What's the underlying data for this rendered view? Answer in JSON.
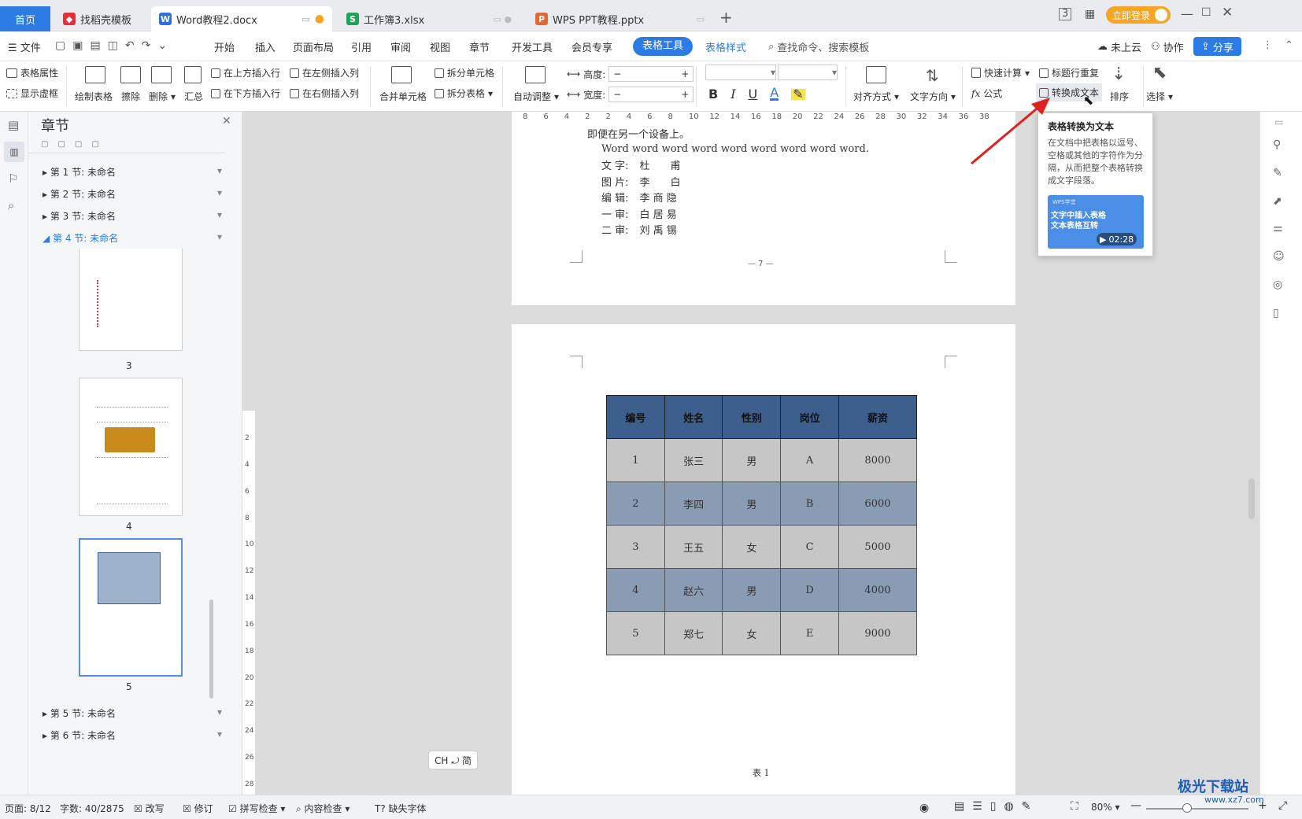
{
  "tabs": {
    "home": "首页",
    "templates": "找稻壳模板",
    "doc": "Word教程2.docx",
    "xls": "工作簿3.xlsx",
    "ppt": "WPS PPT教程.pptx",
    "login": "立即登录"
  },
  "menu": {
    "file": "文件",
    "items": [
      "开始",
      "插入",
      "页面布局",
      "引用",
      "审阅",
      "视图",
      "章节",
      "开发工具",
      "会员专享"
    ],
    "table_tools": "表格工具",
    "table_style": "表格样式",
    "search": "查找命令、搜索模板",
    "cloud": "未上云",
    "collab": "协作",
    "share": "分享"
  },
  "ribbon": {
    "table_props": "表格属性",
    "show_grid": "显示虚框",
    "draw_table": "绘制表格",
    "erase": "擦除",
    "delete": "删除",
    "summary": "汇总",
    "insert_above": "在上方插入行",
    "insert_below": "在下方插入行",
    "insert_left": "在左侧插入列",
    "insert_right": "在右侧插入列",
    "merge": "合并单元格",
    "split_cell": "拆分单元格",
    "split_table": "拆分表格",
    "auto_adjust": "自动调整",
    "height": "高度:",
    "width": "宽度:",
    "align": "对齐方式",
    "text_dir": "文字方向",
    "quick_calc": "快速计算",
    "title_repeat": "标题行重复",
    "formula": "公式",
    "convert_text": "转换成文本",
    "sort": "排序",
    "select": "选择"
  },
  "ruler_ticks": [
    "8",
    "6",
    "4",
    "2",
    "2",
    "4",
    "6",
    "8",
    "10",
    "12",
    "14",
    "16",
    "18",
    "20",
    "22",
    "24",
    "26",
    "28",
    "30",
    "32",
    "34",
    "36",
    "38"
  ],
  "vruler_ticks": [
    "2",
    "4",
    "6",
    "8",
    "10",
    "12",
    "14",
    "16",
    "18",
    "20",
    "22",
    "24",
    "26",
    "28"
  ],
  "panel": {
    "title": "章节",
    "sections": [
      "第 1 节: 未命名",
      "第 2 节: 未命名",
      "第 3 节: 未命名",
      "第 4 节: 未命名",
      "第 5 节: 未命名",
      "第 6 节: 未命名"
    ],
    "page_nums": [
      "3",
      "4",
      "5"
    ]
  },
  "doc": {
    "line0": "即便在另一个设备上。",
    "line1": "Word word word word word word word word word.",
    "credits": [
      {
        "k": "文 字:",
        "v": "杜　　甫"
      },
      {
        "k": "图 片:",
        "v": "李　　白"
      },
      {
        "k": "编 辑:",
        "v": "李 商 隐"
      },
      {
        "k": "一 审:",
        "v": "白 居 易"
      },
      {
        "k": "二 审:",
        "v": "刘 禹 锡"
      }
    ],
    "page_footer": "— 7 —",
    "caption": "表 1",
    "table_header": [
      "编号",
      "姓名",
      "性别",
      "岗位",
      "薪资"
    ],
    "table_rows": [
      [
        "1",
        "张三",
        "男",
        "A",
        "8000"
      ],
      [
        "2",
        "李四",
        "男",
        "B",
        "6000"
      ],
      [
        "3",
        "王五",
        "女",
        "C",
        "5000"
      ],
      [
        "4",
        "赵六",
        "男",
        "D",
        "4000"
      ],
      [
        "5",
        "郑七",
        "女",
        "E",
        "9000"
      ]
    ]
  },
  "tooltip": {
    "title": "表格转换为文本",
    "body": "在文档中把表格以逗号、空格或其他的字符作为分隔，从而把整个表格转换成文字段落。",
    "video_brand": "WPS学堂",
    "video_title": "文字中插入表格 文本表格互转",
    "video_time": "02:28"
  },
  "ime": "CH ⤾ 简",
  "status": {
    "page": "页面: 8/12",
    "words": "字数: 40/2875",
    "rewrite": "改写",
    "revise": "修订",
    "spell": "拼写检查",
    "content": "内容检查",
    "missing_font": "缺失字体",
    "zoom": "80%"
  },
  "watermark": {
    "cn": "极光下载站",
    "url": "www.xz7.com"
  },
  "colors": {
    "accent": "#2c7be5",
    "table_header": "#3d5f8e",
    "row_gray": "#c6c6c6",
    "row_blue": "#8a9cb3",
    "arrow": "#e02020"
  }
}
